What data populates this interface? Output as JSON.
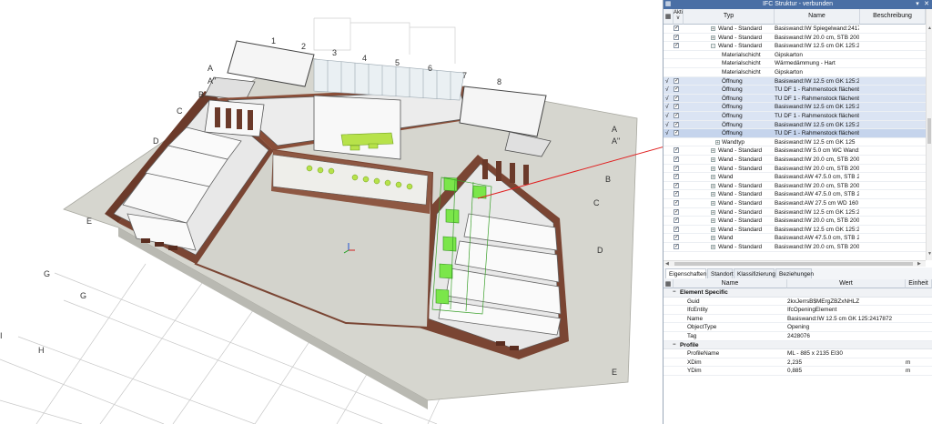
{
  "viewport": {
    "col_labels": [
      "1",
      "2",
      "3",
      "4",
      "5",
      "6",
      "7",
      "8"
    ],
    "row_labels_left": [
      "A",
      "A\"",
      "B",
      "C",
      "D",
      "E"
    ],
    "row_labels_right": [
      "A",
      "A\"",
      "B",
      "C",
      "D",
      "E"
    ],
    "ground_labels": [
      "G",
      "G",
      "H",
      "I"
    ]
  },
  "panel": {
    "title": "IFC Struktur - verbunden",
    "columns": {
      "akt": "Akti\nv",
      "typ": "Typ",
      "name": "Name",
      "beschreibung": "Beschreibung"
    },
    "rows": [
      {
        "typ": "Wand - Standard",
        "name": "Basiswand:IW Spiegelwand:2417...",
        "exp": "+",
        "checked": true,
        "indent": 1
      },
      {
        "typ": "Wand - Standard",
        "name": "Basiswand:IW 20.0 cm, STB 200:...",
        "exp": "+",
        "checked": true,
        "indent": 1
      },
      {
        "typ": "Wand - Standard",
        "name": "Basiswand:IW 12.5 cm GK 125:24...",
        "exp": "-",
        "checked": true,
        "indent": 1
      },
      {
        "typ": "Materialschicht",
        "name": "Gipskarton",
        "indent": 2
      },
      {
        "typ": "Materialschicht",
        "name": "Wärmedämmung - Hart",
        "indent": 2
      },
      {
        "typ": "Materialschicht",
        "name": "Gipskarton",
        "indent": 2
      },
      {
        "typ": "Öffnung",
        "name": "Basiswand:IW 12.5 cm GK 125:24...",
        "checked": true,
        "tick": true,
        "indent": 2,
        "sel": true
      },
      {
        "typ": "Öffnung",
        "name": "TU DF 1 - Rahmenstock flächenbü...",
        "checked": true,
        "tick": true,
        "indent": 2,
        "sel": true
      },
      {
        "typ": "Öffnung",
        "name": "TU DF 1 - Rahmenstock flächenbü...",
        "checked": true,
        "tick": true,
        "indent": 2,
        "sel": true
      },
      {
        "typ": "Öffnung",
        "name": "Basiswand:IW 12.5 cm GK 125:24...",
        "checked": true,
        "tick": true,
        "indent": 2,
        "sel": true
      },
      {
        "typ": "Öffnung",
        "name": "TU DF 1 - Rahmenstock flächenbü...",
        "checked": true,
        "tick": true,
        "indent": 2,
        "sel": true
      },
      {
        "typ": "Öffnung",
        "name": "Basiswand:IW 12.5 cm GK 125:24...",
        "checked": true,
        "tick": true,
        "indent": 2,
        "sel": true
      },
      {
        "typ": "Öffnung",
        "name": "TU DF 1 - Rahmenstock flächenbü...",
        "checked": true,
        "tick": true,
        "indent": 2,
        "sel": true,
        "focus": true
      },
      {
        "typ": "Wandtyp",
        "name": "Basiswand:IW 12.5 cm GK 125",
        "exp": "+",
        "indent": 2
      },
      {
        "typ": "Wand - Standard",
        "name": "Basiswand:IW 5.0 cm WC Wand:...",
        "exp": "+",
        "checked": true,
        "indent": 1
      },
      {
        "typ": "Wand - Standard",
        "name": "Basiswand:IW 20.0 cm, STB 200:...",
        "exp": "+",
        "checked": true,
        "indent": 1
      },
      {
        "typ": "Wand - Standard",
        "name": "Basiswand:IW 20.0 cm, STB 200:...",
        "exp": "+",
        "checked": true,
        "indent": 1
      },
      {
        "typ": "Wand",
        "name": "Basiswand:AW 47.5.0 cm, STB 20...",
        "exp": "+",
        "checked": true,
        "indent": 1
      },
      {
        "typ": "Wand - Standard",
        "name": "Basiswand:IW 20.0 cm, STB 200:...",
        "exp": "+",
        "checked": true,
        "indent": 1
      },
      {
        "typ": "Wand - Standard",
        "name": "Basiswand:AW 47.5.0 cm, STB 20...",
        "exp": "+",
        "checked": true,
        "indent": 1
      },
      {
        "typ": "Wand - Standard",
        "name": "Basiswand:AW 27.5 cm WD 160 V...",
        "exp": "+",
        "checked": true,
        "indent": 1
      },
      {
        "typ": "Wand - Standard",
        "name": "Basiswand:IW 12.5 cm GK 125:24...",
        "exp": "+",
        "checked": true,
        "indent": 1
      },
      {
        "typ": "Wand - Standard",
        "name": "Basiswand:IW 20.0 cm, STB 200:...",
        "exp": "+",
        "checked": true,
        "indent": 1
      },
      {
        "typ": "Wand - Standard",
        "name": "Basiswand:IW 12.5 cm GK 125:24...",
        "exp": "+",
        "checked": true,
        "indent": 1
      },
      {
        "typ": "Wand",
        "name": "Basiswand:AW 47.5.0 cm, STB 20...",
        "exp": "+",
        "checked": true,
        "indent": 1
      },
      {
        "typ": "Wand - Standard",
        "name": "Basiswand:IW 20.0 cm, STB 200:...",
        "exp": "+",
        "checked": true,
        "indent": 1
      }
    ],
    "tabs": [
      "Eigenschaften",
      "Standort",
      "Klassifizierung",
      "Beziehungen"
    ],
    "active_tab": "Eigenschaften",
    "props_header": {
      "name": "Name",
      "wert": "Wert",
      "einheit": "Einheit"
    },
    "groups": [
      {
        "title": "Element Specific",
        "props": [
          {
            "name": "Guid",
            "value": "2kxJerrsB$MErgZBZxNHLZ",
            "unit": ""
          },
          {
            "name": "IfcEntity",
            "value": "IfcOpeningElement",
            "unit": ""
          },
          {
            "name": "Name",
            "value": "Basiswand:IW 12.5 cm GK 125:2417872",
            "unit": ""
          },
          {
            "name": "ObjectType",
            "value": "Opening",
            "unit": ""
          },
          {
            "name": "Tag",
            "value": "2428076",
            "unit": ""
          }
        ]
      },
      {
        "title": "Profile",
        "props": [
          {
            "name": "ProfileName",
            "value": "ML - 885 x 2135 EI30",
            "unit": ""
          },
          {
            "name": "XDim",
            "value": "2,235",
            "unit": "m"
          },
          {
            "name": "YDim",
            "value": "0,885",
            "unit": "m"
          }
        ]
      }
    ]
  }
}
